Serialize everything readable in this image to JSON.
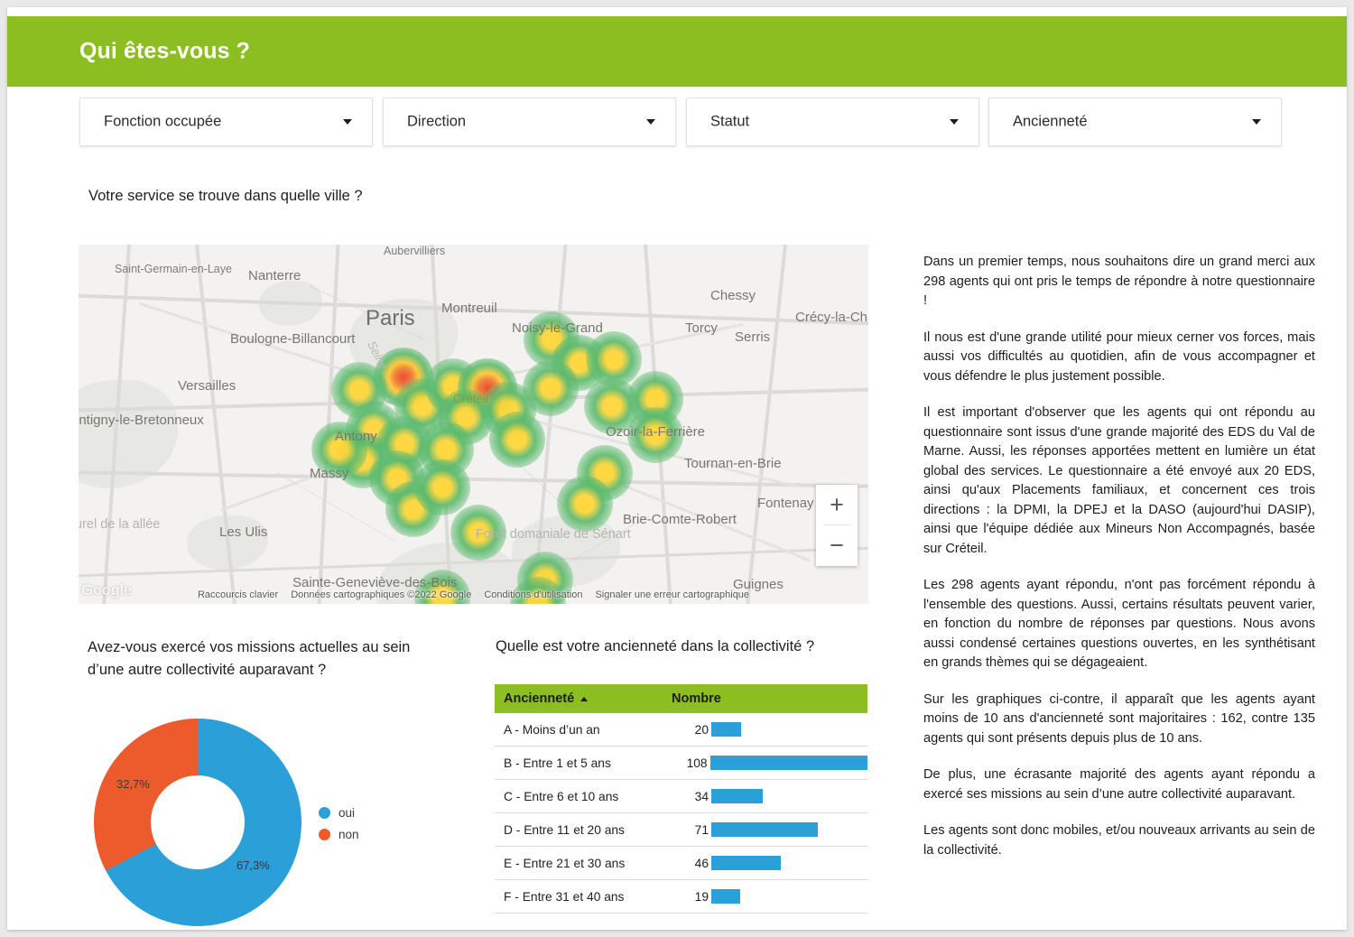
{
  "header": {
    "title": "Qui êtes-vous ?",
    "bar_color": "#8cbe21"
  },
  "filters": [
    {
      "label": "Fonction occupée"
    },
    {
      "label": "Direction"
    },
    {
      "label": "Statut"
    },
    {
      "label": "Ancienneté"
    }
  ],
  "map_section": {
    "question": "Votre service se trouve dans quelle ville ?",
    "provider_watermark": "Google",
    "footer": [
      "Raccourcis clavier",
      "Données cartographiques ©2022 Google",
      "Conditions d'utilisation",
      "Signaler une erreur cartographique"
    ],
    "zoom_in": "+",
    "zoom_out": "−",
    "labels": [
      "Aubervilliers",
      "Saint-Germain-en-Laye",
      "Nanterre",
      "Paris",
      "Montreuil",
      "Noisy-le-Grand",
      "Torcy",
      "Chessy",
      "Serris",
      "Crécy-la-Cha",
      "Boulogne-Billancourt",
      "Versailles",
      "Créteil",
      "Ozoir-la-Ferrière",
      "ontigny-le-Bretonneux",
      "Antony",
      "Tournan-en-Brie",
      "Massy",
      "Fontenay",
      "Brie-Comte-Robert",
      "Les Ulis",
      "Sainte-Geneviève-des-Bois",
      "Guignes",
      "Seine",
      "Forêt domaniale de Sénart",
      "turel de la allée"
    ]
  },
  "donut_section": {
    "question": "Avez-vous exercé vos missions actuelles au sein d’une autre collectivité auparavant ?",
    "labels": {
      "oui": "67,3%",
      "non": "32,7%"
    },
    "legend": [
      {
        "name": "oui",
        "color": "#2b9fd8"
      },
      {
        "name": "non",
        "color": "#ec5b2b"
      }
    ]
  },
  "table_section": {
    "question": "Quelle est votre ancienneté dans la collectivité ?",
    "columns": [
      "Ancienneté",
      "Nombre"
    ],
    "sort_indicator": "ascending",
    "rows": [
      {
        "label": "A - Moins d’un an",
        "value": "20",
        "bar_pct": 18.5
      },
      {
        "label": "B - Entre 1 et 5 ans",
        "value": "108",
        "bar_pct": 100
      },
      {
        "label": "C - Entre 6 et 10 ans",
        "value": "34",
        "bar_pct": 31.5
      },
      {
        "label": "D - Entre 11 et 20 ans",
        "value": "71",
        "bar_pct": 65.7
      },
      {
        "label": "E - Entre 21 et 30 ans",
        "value": "46",
        "bar_pct": 42.6
      },
      {
        "label": "F - Entre 31 et 40 ans",
        "value": "19",
        "bar_pct": 17.6
      }
    ]
  },
  "side_text": {
    "p1": "Dans un premier temps, nous souhaitons dire un grand merci aux 298 agents qui ont pris le temps de répondre à notre questionnaire !",
    "p2": "Il nous est d'une grande utilité pour mieux cerner vos forces, mais aussi vos difficultés au quotidien, afin de vous accompagner et vous défendre le plus justement possible.",
    "p3": "Il est important d'observer que les agents qui ont répondu au questionnaire sont issus d'une grande majorité des EDS du Val de Marne.  Aussi, les réponses apportées mettent en lumière un état global des services. Le questionnaire a été envoyé aux 20 EDS, ainsi qu'aux Placements familiaux, et concernent ces trois directions : la DPMI, la DPEJ et la DASO (aujourd'hui DASIP), ainsi que l'équipe dédiée aux Mineurs Non Accompagnés, basée sur Créteil.",
    "p4": "Les 298 agents ayant répondu, n'ont pas forcément répondu à l'ensemble des questions. Aussi, certains résultats peuvent varier, en fonction du nombre de réponses par questions. Nous avons aussi condensé certaines questions ouvertes, en les synthétisant en grands thèmes qui se dégageaient.",
    "p5": "Sur les graphiques ci-contre, il apparaît que les agents ayant moins de 10 ans d'ancienneté sont majoritaires : 162, contre 135 agents qui sont présents depuis plus de 10 ans.",
    "p6": "De plus, une écrasante majorité des agents ayant répondu a exercé ses missions au sein d’une autre collectivité auparavant.",
    "p7": "Les agents sont donc mobiles, et/ou nouveaux arrivants au sein de la collectivité."
  },
  "chart_data": [
    {
      "type": "pie",
      "title": "Avez-vous exercé vos missions actuelles au sein d’une autre collectivité auparavant ?",
      "categories": [
        "oui",
        "non"
      ],
      "values": [
        67.3,
        32.7
      ],
      "value_labels": [
        "67,3%",
        "32,7%"
      ],
      "colors": [
        "#2b9fd8",
        "#ec5b2b"
      ],
      "donut": true,
      "legend_position": "right"
    },
    {
      "type": "bar",
      "title": "Quelle est votre ancienneté dans la collectivité ?",
      "orientation": "horizontal",
      "categories": [
        "A - Moins d’un an",
        "B - Entre 1 et 5 ans",
        "C - Entre 6 et 10 ans",
        "D - Entre 11 et 20 ans",
        "E - Entre 21 et 30 ans",
        "F - Entre 31 et 40 ans"
      ],
      "values": [
        20,
        108,
        34,
        71,
        46,
        19
      ],
      "xlabel": "Nombre",
      "ylabel": "Ancienneté",
      "xlim": [
        0,
        108
      ],
      "grid": false,
      "color": "#2b9fd8"
    },
    {
      "type": "heatmap",
      "title": "Votre service se trouve dans quelle ville ?",
      "description": "Carte de densité des villes où se trouvent les services, région Île-de-France centrée sur Créteil / Val-de-Marne",
      "intensity_scale": [
        "vert (faible)",
        "jaune (moyen)",
        "rouge (fort)"
      ]
    }
  ]
}
